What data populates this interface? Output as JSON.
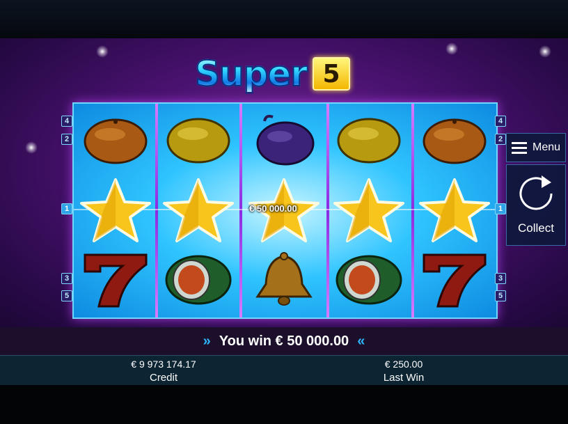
{
  "game": {
    "title": "Super",
    "title_badge": "5"
  },
  "reels": {
    "rows": [
      [
        "orange",
        "lemon",
        "plum",
        "lemon",
        "orange"
      ],
      [
        "star",
        "star",
        "star",
        "star",
        "star"
      ],
      [
        "seven",
        "watermelon",
        "bell",
        "watermelon",
        "seven"
      ]
    ],
    "line_win_label": "€ 50 000.00"
  },
  "paylines": {
    "left_top": "4",
    "left_upper": "2",
    "left_mid": "1",
    "left_lower": "3",
    "left_bottom": "5",
    "right_top": "4",
    "right_upper": "2",
    "right_mid": "1",
    "right_lower": "3",
    "right_bottom": "5"
  },
  "side_menu": {
    "menu_label": "Menu",
    "collect_label": "Collect"
  },
  "win_bar": {
    "text": "You win € 50 000.00",
    "chev_left": "»",
    "chev_right": "«"
  },
  "info": {
    "credit_value": "€ 9 973 174.17",
    "credit_label": "Credit",
    "last_win_value": "€ 250.00",
    "last_win_label": "Last Win"
  }
}
